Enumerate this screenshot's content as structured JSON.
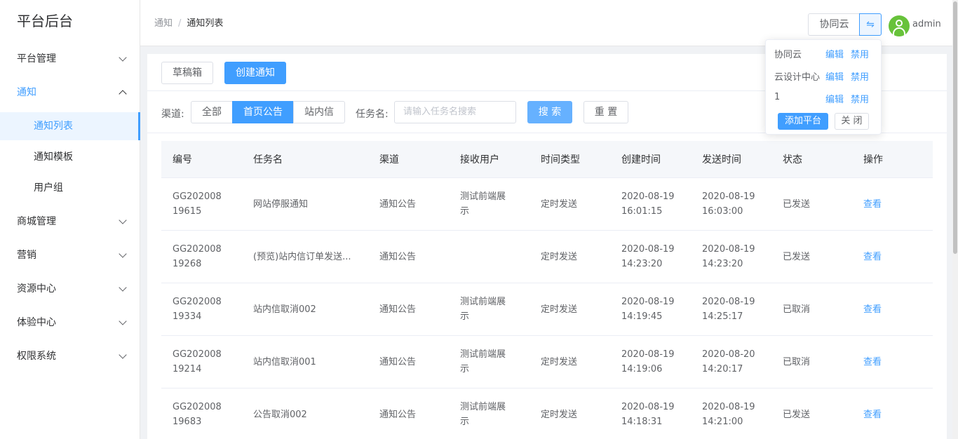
{
  "sidebar": {
    "title": "平台后台",
    "menu": [
      {
        "label": "平台管理"
      },
      {
        "label": "通知"
      },
      {
        "label": "商城管理"
      },
      {
        "label": "营销"
      },
      {
        "label": "资源中心"
      },
      {
        "label": "体验中心"
      },
      {
        "label": "权限系统"
      }
    ],
    "submenu": [
      {
        "label": "通知列表"
      },
      {
        "label": "通知模板"
      },
      {
        "label": "用户组"
      }
    ]
  },
  "header": {
    "breadcrumb": [
      "通知",
      "/",
      "通知列表"
    ],
    "platform": "协同云",
    "swap_icon": "⇋",
    "username": "admin"
  },
  "toolbar": {
    "drafts": "草稿箱",
    "create": "创建通知"
  },
  "filter": {
    "channel_label": "渠道:",
    "channels": [
      "全部",
      "首页公告",
      "站内信"
    ],
    "task_label": "任务名:",
    "task_placeholder": "请输入任务名搜索",
    "search": "搜 索",
    "reset": "重 置"
  },
  "table": {
    "headers": [
      "编号",
      "任务名",
      "渠道",
      "接收用户",
      "时间类型",
      "创建时间",
      "发送时间",
      "状态",
      "操作"
    ],
    "rows": [
      {
        "id": "GG20200819615",
        "name": "网站停服通知",
        "channel": "通知公告",
        "users": "测试前端展示",
        "timetype": "定时发送",
        "created": "2020-08-19 16:01:15",
        "sent": "2020-08-19 16:03:00",
        "status": "已发送",
        "action": "查看"
      },
      {
        "id": "GG20200819268",
        "name": "(预览)站内信订单发送...",
        "channel": "通知公告",
        "users": "",
        "timetype": "定时发送",
        "created": "2020-08-19 14:23:20",
        "sent": "2020-08-19 14:23:20",
        "status": "已发送",
        "action": "查看"
      },
      {
        "id": "GG20200819334",
        "name": "站内信取消002",
        "channel": "通知公告",
        "users": "测试前端展示",
        "timetype": "定时发送",
        "created": "2020-08-19 14:19:45",
        "sent": "2020-08-19 14:25:17",
        "status": "已取消",
        "action": "查看"
      },
      {
        "id": "GG20200819214",
        "name": "站内信取消001",
        "channel": "通知公告",
        "users": "测试前端展示",
        "timetype": "定时发送",
        "created": "2020-08-19 14:19:06",
        "sent": "2020-08-20 14:20:17",
        "status": "已取消",
        "action": "查看"
      },
      {
        "id": "GG20200819683",
        "name": "公告取消002",
        "channel": "通知公告",
        "users": "测试前端展示",
        "timetype": "定时发送",
        "created": "2020-08-19 14:18:31",
        "sent": "2020-08-19 14:21:00",
        "status": "已发送",
        "action": "查看"
      }
    ]
  },
  "popover": {
    "items": [
      {
        "name": "协同云",
        "edit": "编辑",
        "disable": "禁用"
      },
      {
        "name": "云设计中心",
        "edit": "编辑",
        "disable": "禁用"
      },
      {
        "name": "1",
        "edit": "编辑",
        "disable": "禁用"
      }
    ],
    "add": "添加平台",
    "close": "关 闭"
  }
}
